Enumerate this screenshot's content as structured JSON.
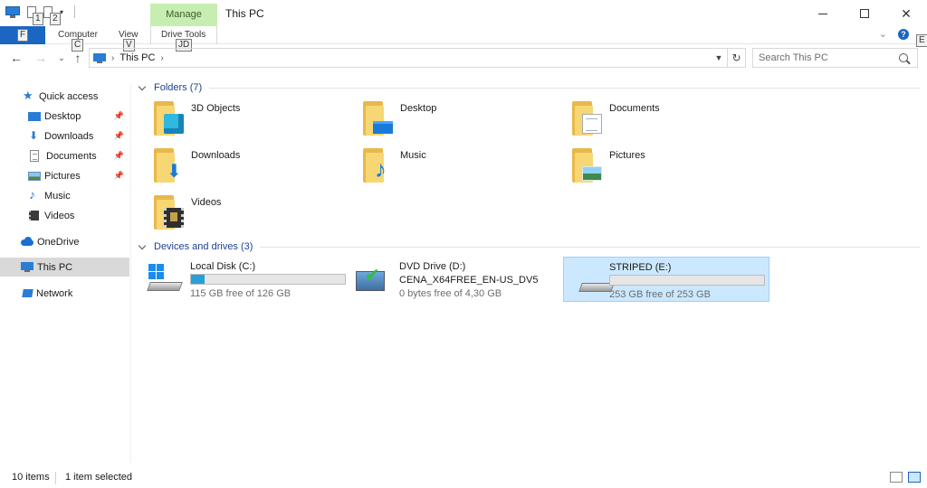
{
  "window": {
    "title": "This PC",
    "context_tab": "Manage"
  },
  "ribbon": {
    "file_keytip": "F",
    "qat_keytips": [
      "1",
      "2"
    ],
    "tabs": [
      {
        "label": "Computer",
        "keytip": "C"
      },
      {
        "label": "View",
        "keytip": "V"
      },
      {
        "label": "Drive Tools",
        "keytip": "JD"
      }
    ],
    "help_keytip": "E",
    "help_glyph": "?"
  },
  "nav": {
    "breadcrumb": "This PC",
    "search_placeholder": "Search This PC"
  },
  "sidebar": {
    "items": [
      {
        "label": "Quick access"
      },
      {
        "label": "Desktop"
      },
      {
        "label": "Downloads"
      },
      {
        "label": "Documents"
      },
      {
        "label": "Pictures"
      },
      {
        "label": "Music"
      },
      {
        "label": "Videos"
      },
      {
        "label": "OneDrive"
      },
      {
        "label": "This PC"
      },
      {
        "label": "Network"
      }
    ]
  },
  "folders_group": {
    "title": "Folders (7)",
    "items": [
      {
        "label": "3D Objects",
        "icon": "3d-objects-folder-icon"
      },
      {
        "label": "Desktop",
        "icon": "desktop-folder-icon"
      },
      {
        "label": "Documents",
        "icon": "documents-folder-icon"
      },
      {
        "label": "Downloads",
        "icon": "downloads-folder-icon"
      },
      {
        "label": "Music",
        "icon": "music-folder-icon"
      },
      {
        "label": "Pictures",
        "icon": "pictures-folder-icon"
      },
      {
        "label": "Videos",
        "icon": "videos-folder-icon"
      }
    ]
  },
  "drives_group": {
    "title": "Devices and drives (3)",
    "items": [
      {
        "name": "Local Disk (C:)",
        "free": "115 GB free of 126 GB",
        "used_fraction": 0.09
      },
      {
        "name": "DVD Drive (D:)",
        "volume": "CENA_X64FREE_EN-US_DV5",
        "free": "0 bytes free of 4,30 GB"
      },
      {
        "name": "STRIPED (E:)",
        "free": "253 GB free of 253 GB",
        "used_fraction": 0.0
      }
    ]
  },
  "status": {
    "items_count": "10 items",
    "selected": "1 item selected"
  },
  "colors": {
    "accent": "#1a66c2",
    "manage_tab": "#c7eeb1",
    "drive_fill": "#26a0da",
    "selection": "#cce8ff"
  }
}
